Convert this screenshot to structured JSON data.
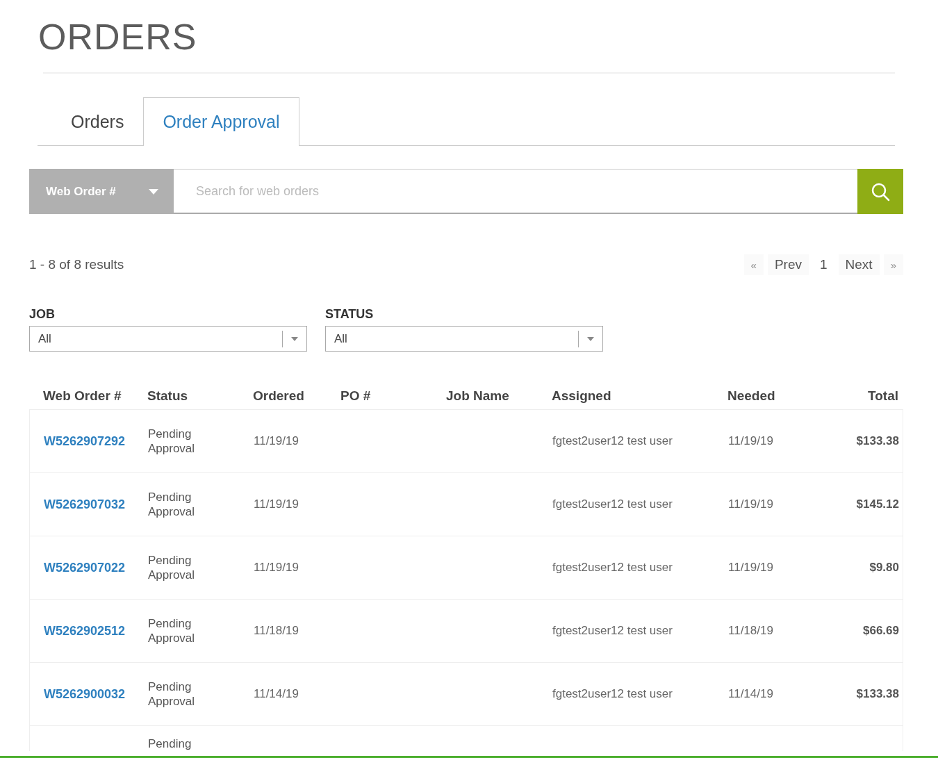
{
  "title": "ORDERS",
  "tabs": [
    {
      "label": "Orders",
      "selected": false
    },
    {
      "label": "Order Approval",
      "selected": true
    }
  ],
  "search": {
    "filter_label": "Web Order #",
    "placeholder": "Search for web orders"
  },
  "results_summary": "1 - 8 of 8 results",
  "pagination": {
    "first": "«",
    "prev": "Prev",
    "page": "1",
    "next": "Next",
    "last": "»"
  },
  "filters": [
    {
      "label": "JOB",
      "value": "All"
    },
    {
      "label": "STATUS",
      "value": "All"
    }
  ],
  "table": {
    "columns": [
      "Web Order #",
      "Status",
      "Ordered",
      "PO #",
      "Job Name",
      "Assigned",
      "Needed",
      "Total"
    ],
    "rows": [
      {
        "web_order": "W5262907292",
        "status": "Pending Approval",
        "ordered": "11/19/19",
        "assigned": "fgtest2user12 test user",
        "needed": "11/19/19",
        "total": "$133.38"
      },
      {
        "web_order": "W5262907032",
        "status": "Pending Approval",
        "ordered": "11/19/19",
        "assigned": "fgtest2user12 test user",
        "needed": "11/19/19",
        "total": "$145.12"
      },
      {
        "web_order": "W5262907022",
        "status": "Pending Approval",
        "ordered": "11/19/19",
        "assigned": "fgtest2user12 test user",
        "needed": "11/19/19",
        "total": "$9.80"
      },
      {
        "web_order": "W5262902512",
        "status": "Pending Approval",
        "ordered": "11/18/19",
        "assigned": "fgtest2user12 test user",
        "needed": "11/18/19",
        "total": "$66.69"
      },
      {
        "web_order": "W5262900032",
        "status": "Pending Approval",
        "ordered": "11/14/19",
        "assigned": "fgtest2user12 test user",
        "needed": "11/14/19",
        "total": "$133.38"
      },
      {
        "status": "Pending"
      }
    ]
  }
}
